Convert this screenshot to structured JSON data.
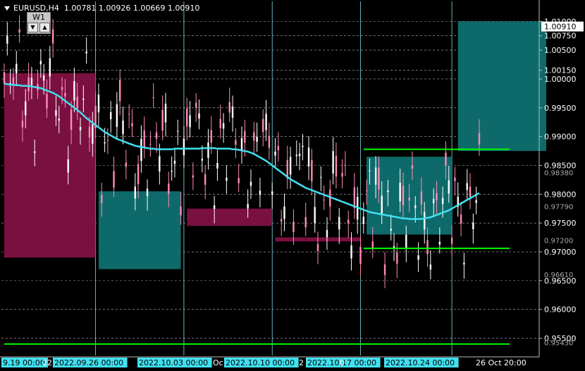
{
  "header": {
    "symbol_timeframe": "EURUSD,H4",
    "ohlc": "1.00781 1.00926 1.00669 1.00910"
  },
  "timeframe_panel": {
    "label": "W1",
    "down_glyph": "▼",
    "up_glyph": "▲"
  },
  "colors": {
    "background": "#000000",
    "bull_candle": "#ff8ab8",
    "bear_candle": "#ffffff",
    "ma_line": "#41e0f0",
    "h_line": "#00ff00",
    "zone_maroon": "#7a1040",
    "zone_teal": "#0e6a6a",
    "grid": "#b0b0b0",
    "vline": "#7fe0e8"
  },
  "chart_data": {
    "type": "candlestick",
    "y_range": [
      0.9525,
      1.0115
    ],
    "y_ticks": [
      "1.01000",
      "1.00750",
      "1.00500",
      "1.00150",
      "1.00000",
      "0.99500",
      "0.99000",
      "0.98500",
      "0.98000",
      "0.97500",
      "0.97000",
      "0.96500",
      "0.96000",
      "0.95500"
    ],
    "y_special_labels": [
      "1.00910",
      "0.98380",
      "0.97790",
      "0.97200",
      "0.96610",
      "0.95430"
    ],
    "x_ticks": [
      "9.19 00:00",
      "22",
      "2022.09.26 00:00",
      "2022.10.03 00:00",
      "Oc",
      "2022.10.10 00:00",
      "2",
      "2022.10.17 00:00",
      "0",
      "2022.10.24 00:00",
      "26 Oct 20:00"
    ],
    "price_label": "1.00910",
    "zones": [
      {
        "color": "maroon",
        "from_index": 0,
        "to_index": 30,
        "top": 1.001,
        "bottom": 0.969
      },
      {
        "color": "teal",
        "from_index": 31,
        "to_index": 58,
        "top": 0.9805,
        "bottom": 0.967
      },
      {
        "color": "maroon",
        "from_index": 60,
        "to_index": 88,
        "top": 0.9775,
        "bottom": 0.9745
      },
      {
        "color": "maroon",
        "from_index": 89,
        "to_index": 117,
        "top": 0.9725,
        "bottom": 0.9718
      },
      {
        "color": "teal",
        "from_index": 119,
        "to_index": 147,
        "top": 0.9865,
        "bottom": 0.973
      },
      {
        "color": "teal",
        "from_index": 149,
        "to_index": 178,
        "top": 1.01,
        "bottom": 0.9875
      }
    ],
    "h_lines": [
      {
        "price": 0.9878,
        "from_index": 118,
        "to_index": 166
      },
      {
        "price": 0.9706,
        "from_index": 118,
        "to_index": 166
      },
      {
        "price": 0.954,
        "from_index": 0,
        "to_index": 166
      }
    ],
    "ma_values": [
      0.9992,
      0.9991,
      0.999,
      0.999,
      0.9989,
      0.9989,
      0.9988,
      0.9988,
      0.9988,
      0.9987,
      0.9986,
      0.9985,
      0.9984,
      0.9982,
      0.998,
      0.9978,
      0.9976,
      0.9973,
      0.997,
      0.9966,
      0.9962,
      0.9958,
      0.9954,
      0.995,
      0.9946,
      0.9942,
      0.9937,
      0.9932,
      0.9928,
      0.9924,
      0.992,
      0.9916,
      0.9912,
      0.9908,
      0.9905,
      0.9902,
      0.9899,
      0.9896,
      0.9894,
      0.9892,
      0.989,
      0.9888,
      0.9886,
      0.9884,
      0.9883,
      0.9882,
      0.9881,
      0.988,
      0.9879,
      0.9879,
      0.9878,
      0.9878,
      0.9878,
      0.9878,
      0.9878,
      0.9878,
      0.9879,
      0.9879,
      0.9879,
      0.9879,
      0.9879,
      0.9879,
      0.9879,
      0.9879,
      0.9879,
      0.988,
      0.988,
      0.988,
      0.988,
      0.988,
      0.9879,
      0.9879,
      0.9879,
      0.9879,
      0.9879,
      0.9878,
      0.9878,
      0.9877,
      0.9876,
      0.9875,
      0.9874,
      0.9872,
      0.987,
      0.9867,
      0.9864,
      0.9861,
      0.9858,
      0.9854,
      0.985,
      0.9846,
      0.9842,
      0.9838,
      0.9834,
      0.983,
      0.9826,
      0.9823,
      0.982,
      0.9817,
      0.9814,
      0.9811,
      0.9809,
      0.9807,
      0.9805,
      0.9803,
      0.9801,
      0.9799,
      0.9797,
      0.9795,
      0.9793,
      0.9791,
      0.9789,
      0.9787,
      0.9785,
      0.9783,
      0.9781,
      0.9779,
      0.9777,
      0.9775,
      0.9773,
      0.9771,
      0.9769,
      0.9768,
      0.9767,
      0.9766,
      0.9765,
      0.9764,
      0.9763,
      0.9762,
      0.9761,
      0.976,
      0.9759,
      0.9758,
      0.9758,
      0.9757,
      0.9757,
      0.9757,
      0.9757,
      0.9757,
      0.9758,
      0.9759,
      0.976,
      0.9762,
      0.9764,
      0.9766,
      0.9768,
      0.977,
      0.9772,
      0.9775,
      0.9778,
      0.9781,
      0.9784,
      0.9787,
      0.979,
      0.9793,
      0.9796,
      0.9799,
      0.9802
    ]
  }
}
